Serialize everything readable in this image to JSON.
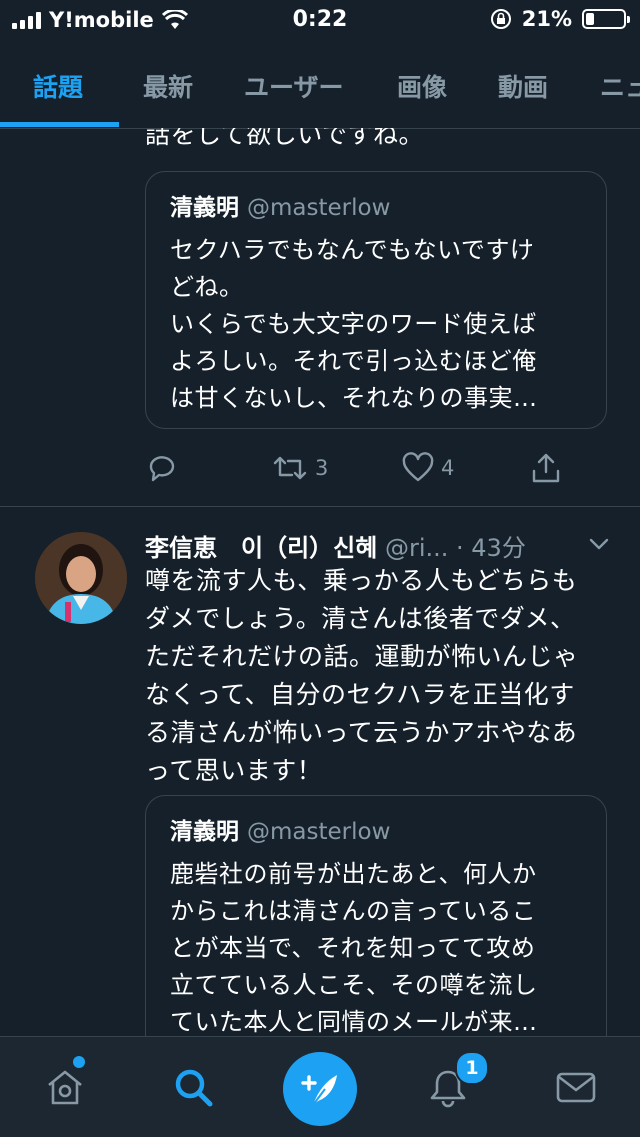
{
  "status": {
    "carrier": "Y!mobile",
    "time": "0:22",
    "battery": "21%",
    "battery_level": 0.21
  },
  "tabs": [
    {
      "label": "話題",
      "active": true
    },
    {
      "label": "最新"
    },
    {
      "label": "ユーザー"
    },
    {
      "label": "画像"
    },
    {
      "label": "動画"
    },
    {
      "label": "ニュ"
    }
  ],
  "tweet1": {
    "text_tail": "話をして欲しいですね。",
    "quote": {
      "name": "清義明",
      "handle": "@masterlow",
      "lines": [
        "セクハラでもなんでもないですけ",
        "どね。",
        "いくらでも大文字のワード使えば",
        "よろしい。それで引っ込むほど俺",
        "は甘くないし、それなりの事実…"
      ]
    },
    "retweets": "3",
    "likes": "4"
  },
  "tweet2": {
    "name": "李信恵　이（리）신혜",
    "handle": "@ri...",
    "time": "· 43分",
    "lines": [
      "噂を流す人も、乗っかる人もどちらも",
      "ダメでしょう。清さんは後者でダメ、",
      "ただそれだけの話。運動が怖いんじゃ",
      "なくって、自分のセクハラを正当化す",
      "る清さんが怖いって云うかアホやなあ",
      "って思います！"
    ],
    "quote": {
      "name": "清義明",
      "handle": "@masterlow",
      "lines": [
        "鹿砦社の前号が出たあと、何人か",
        "からこれは清さんの言っているこ",
        "とが本当で、それを知ってて攻め",
        "立てている人こそ、その噂を流し",
        "ていた本人と同情のメールが来…"
      ]
    }
  },
  "bottom_nav": {
    "notification_count": "1"
  },
  "colors": {
    "background": "#15202b",
    "accent": "#1da1f2",
    "muted": "#8899a6",
    "border": "#38444d"
  }
}
